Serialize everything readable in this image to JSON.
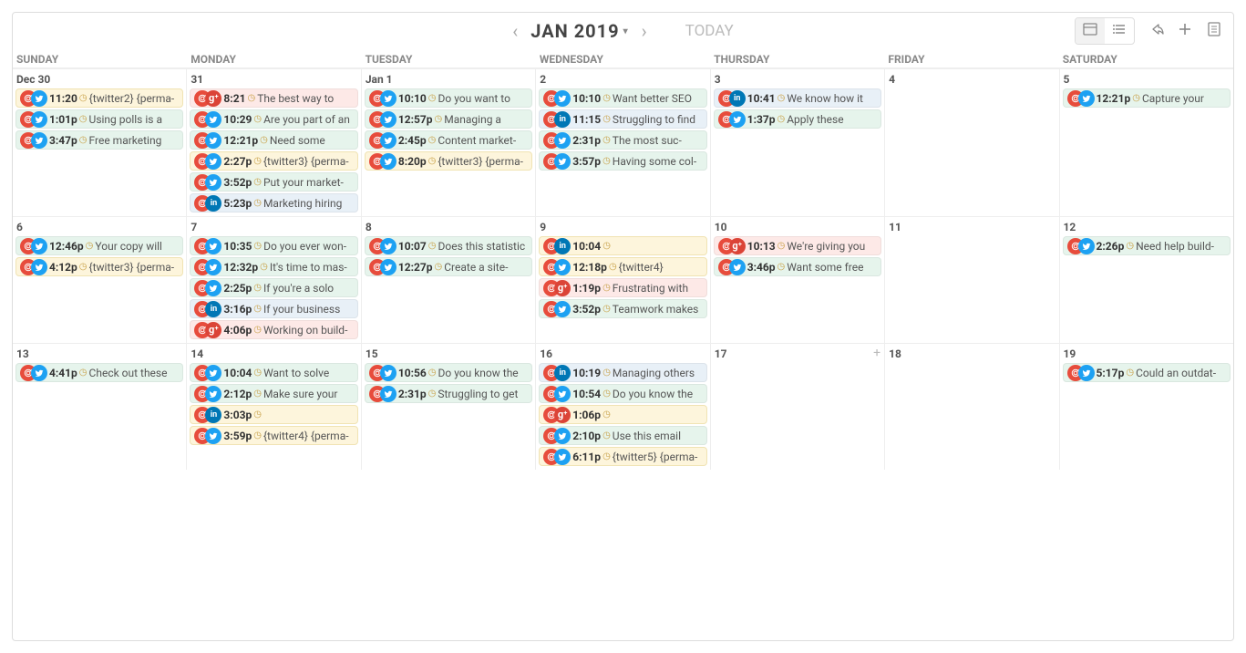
{
  "toolbar": {
    "month": "JAN 2019",
    "today": "TODAY"
  },
  "dows": [
    "SUNDAY",
    "MONDAY",
    "TUESDAY",
    "WEDNESDAY",
    "THURSDAY",
    "FRIDAY",
    "SATURDAY"
  ],
  "weeks": [
    {
      "days": [
        {
          "num": "Dec 30",
          "events": [
            {
              "net": "tw",
              "cls": "pm",
              "time": "11:20",
              "txt": "{twitter2} {perma-"
            },
            {
              "net": "tw",
              "cls": "tw",
              "time": "1:01p",
              "txt": "Using polls is a"
            },
            {
              "net": "tw",
              "cls": "tw",
              "time": "3:47p",
              "txt": "Free marketing"
            }
          ]
        },
        {
          "num": "31",
          "events": [
            {
              "net": "gp",
              "cls": "gp",
              "time": "8:21",
              "txt": "The best way to"
            },
            {
              "net": "tw",
              "cls": "tw",
              "time": "10:29",
              "txt": "Are you part of an"
            },
            {
              "net": "tw",
              "cls": "tw",
              "time": "12:21p",
              "txt": "Need some"
            },
            {
              "net": "tw",
              "cls": "pm",
              "time": "2:27p",
              "txt": "{twitter3} {perma-"
            },
            {
              "net": "tw",
              "cls": "tw",
              "time": "3:52p",
              "txt": "Put your market-"
            },
            {
              "net": "in",
              "cls": "in",
              "time": "5:23p",
              "txt": "Marketing hiring"
            }
          ]
        },
        {
          "num": "Jan 1",
          "events": [
            {
              "net": "tw",
              "cls": "tw",
              "time": "10:10",
              "txt": "Do you want to"
            },
            {
              "net": "tw",
              "cls": "tw",
              "time": "12:57p",
              "txt": "Managing a"
            },
            {
              "net": "tw",
              "cls": "tw",
              "time": "2:45p",
              "txt": "Content market-"
            },
            {
              "net": "tw",
              "cls": "pm",
              "time": "8:20p",
              "txt": "{twitter3} {perma-"
            }
          ]
        },
        {
          "num": "2",
          "events": [
            {
              "net": "tw",
              "cls": "tw",
              "time": "10:10",
              "txt": "Want better SEO"
            },
            {
              "net": "in",
              "cls": "in",
              "time": "11:15",
              "txt": "Struggling to find"
            },
            {
              "net": "tw",
              "cls": "tw",
              "time": "2:31p",
              "txt": "The most suc-"
            },
            {
              "net": "tw",
              "cls": "tw",
              "time": "3:57p",
              "txt": "Having some col-"
            }
          ]
        },
        {
          "num": "3",
          "events": [
            {
              "net": "in",
              "cls": "in",
              "time": "10:41",
              "txt": "We know how it"
            },
            {
              "net": "tw",
              "cls": "tw",
              "time": "1:37p",
              "txt": "Apply these"
            }
          ]
        },
        {
          "num": "4",
          "events": []
        },
        {
          "num": "5",
          "events": [
            {
              "net": "tw",
              "cls": "tw",
              "time": "12:21p",
              "txt": "Capture your"
            }
          ]
        }
      ]
    },
    {
      "days": [
        {
          "num": "6",
          "events": [
            {
              "net": "tw",
              "cls": "tw",
              "time": "12:46p",
              "txt": "Your copy will"
            },
            {
              "net": "tw",
              "cls": "pm",
              "time": "4:12p",
              "txt": "{twitter3} {perma-"
            }
          ]
        },
        {
          "num": "7",
          "events": [
            {
              "net": "tw",
              "cls": "tw",
              "time": "10:35",
              "txt": "Do you ever won-"
            },
            {
              "net": "tw",
              "cls": "tw",
              "time": "12:32p",
              "txt": "It's time to mas-"
            },
            {
              "net": "tw",
              "cls": "tw",
              "time": "2:25p",
              "txt": "If you're a solo"
            },
            {
              "net": "in",
              "cls": "in",
              "time": "3:16p",
              "txt": "If your business"
            },
            {
              "net": "gp",
              "cls": "gp",
              "time": "4:06p",
              "txt": "Working on build-"
            }
          ]
        },
        {
          "num": "8",
          "events": [
            {
              "net": "tw",
              "cls": "tw",
              "time": "10:07",
              "txt": "Does this statistic"
            },
            {
              "net": "tw",
              "cls": "tw",
              "time": "12:27p",
              "txt": "Create a site-"
            }
          ]
        },
        {
          "num": "9",
          "events": [
            {
              "net": "in",
              "cls": "pm",
              "time": "10:04",
              "txt": ""
            },
            {
              "net": "tw",
              "cls": "pm",
              "time": "12:18p",
              "txt": "{twitter4}"
            },
            {
              "net": "gp",
              "cls": "gp",
              "time": "1:19p",
              "txt": "Frustrating with"
            },
            {
              "net": "tw",
              "cls": "tw",
              "time": "3:52p",
              "txt": "Teamwork makes"
            }
          ]
        },
        {
          "num": "10",
          "events": [
            {
              "net": "gp",
              "cls": "gp",
              "time": "10:13",
              "txt": "We're giving you"
            },
            {
              "net": "tw",
              "cls": "tw",
              "time": "3:46p",
              "txt": "Want some free"
            }
          ]
        },
        {
          "num": "11",
          "events": []
        },
        {
          "num": "12",
          "events": [
            {
              "net": "tw",
              "cls": "tw",
              "time": "2:26p",
              "txt": "Need help build-"
            }
          ]
        }
      ]
    },
    {
      "days": [
        {
          "num": "13",
          "events": [
            {
              "net": "tw",
              "cls": "tw",
              "time": "4:41p",
              "txt": "Check out these"
            }
          ]
        },
        {
          "num": "14",
          "events": [
            {
              "net": "tw",
              "cls": "tw",
              "time": "10:04",
              "txt": "Want to solve"
            },
            {
              "net": "tw",
              "cls": "tw",
              "time": "2:12p",
              "txt": "Make sure your"
            },
            {
              "net": "in",
              "cls": "pm",
              "time": "3:03p",
              "txt": ""
            },
            {
              "net": "tw",
              "cls": "pm",
              "time": "3:59p",
              "txt": "{twitter4} {perma-"
            }
          ]
        },
        {
          "num": "15",
          "events": [
            {
              "net": "tw",
              "cls": "tw",
              "time": "10:56",
              "txt": "Do you know the"
            },
            {
              "net": "tw",
              "cls": "tw",
              "time": "2:31p",
              "txt": "Struggling to get"
            }
          ]
        },
        {
          "num": "16",
          "events": [
            {
              "net": "in",
              "cls": "in",
              "time": "10:19",
              "txt": "Managing others"
            },
            {
              "net": "tw",
              "cls": "tw",
              "time": "10:54",
              "txt": "Do you know the"
            },
            {
              "net": "gp",
              "cls": "pm",
              "time": "1:06p",
              "txt": ""
            },
            {
              "net": "tw",
              "cls": "tw",
              "time": "2:10p",
              "txt": "Use this email"
            },
            {
              "net": "tw",
              "cls": "pm",
              "time": "6:11p",
              "txt": "{twitter5} {perma-"
            }
          ]
        },
        {
          "num": "17",
          "hoverAdd": true,
          "events": []
        },
        {
          "num": "18",
          "events": []
        },
        {
          "num": "19",
          "events": [
            {
              "net": "tw",
              "cls": "tw",
              "time": "5:17p",
              "txt": "Could an outdat-"
            }
          ]
        }
      ]
    }
  ]
}
